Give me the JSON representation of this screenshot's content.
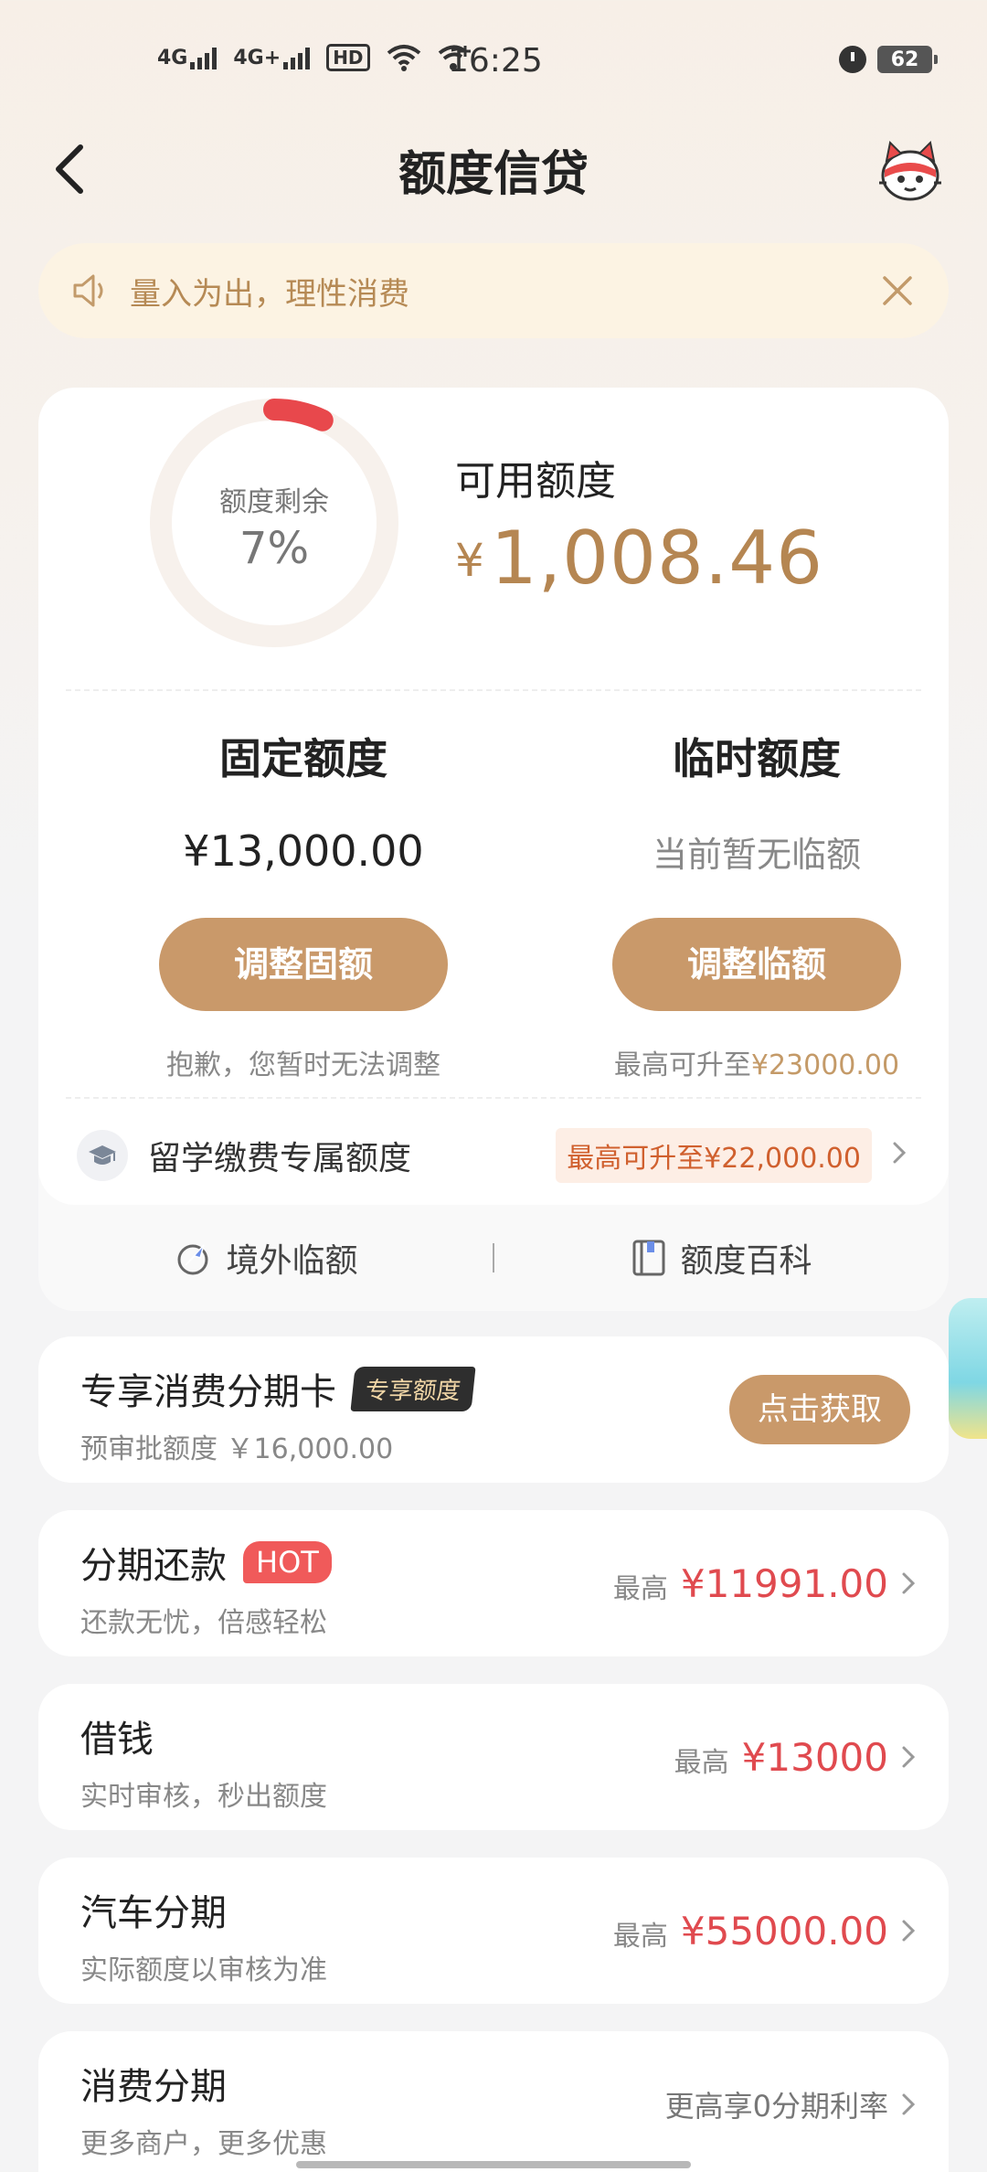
{
  "status_bar": {
    "sig1": "4G",
    "sig2": "4G+",
    "hd": "HD",
    "time": "16:25",
    "battery": "62"
  },
  "nav": {
    "title": "额度信贷"
  },
  "notice": {
    "text": "量入为出，理性消费"
  },
  "credit": {
    "ring_label": "额度剩余",
    "ring_percent": "7%",
    "ring_fraction": 0.07,
    "available_label": "可用额度",
    "available_currency": "¥",
    "available_amount": "1,008.46",
    "fixed": {
      "title": "固定额度",
      "value": "¥13,000.00",
      "button": "调整固额",
      "note": "抱歉，您暂时无法调整"
    },
    "temp": {
      "title": "临时额度",
      "value": "当前暂无临额",
      "button": "调整临额",
      "note_prefix": "最高可升至",
      "note_amount": "¥23000.00"
    },
    "study": {
      "label": "留学缴费专属额度",
      "tag": "最高可升至¥22,000.00"
    },
    "links": {
      "overseas": "境外临额",
      "wiki": "额度百科"
    }
  },
  "cards": {
    "installment_card": {
      "title": "专享消费分期卡",
      "tag": "专享额度",
      "sub": "预审批额度 ￥16,000.00",
      "button": "点击获取"
    },
    "repay": {
      "title": "分期还款",
      "tag": "HOT",
      "sub": "还款无忧，倍感轻松",
      "prefix": "最高",
      "amount": "¥11991.00"
    },
    "borrow": {
      "title": "借钱",
      "sub": "实时审核，秒出额度",
      "prefix": "最高",
      "amount": "¥13000"
    },
    "car": {
      "title": "汽车分期",
      "sub": "实际额度以审核为准",
      "prefix": "最高",
      "amount": "¥55000.00"
    },
    "consumer": {
      "title": "消费分期",
      "sub": "更多商户，更多优惠",
      "note": "更高享0分期利率"
    }
  },
  "colors": {
    "gold": "#c9996a",
    "gold_text": "#b58652",
    "red": "#e04a4f",
    "ring_red": "#e8484c"
  }
}
